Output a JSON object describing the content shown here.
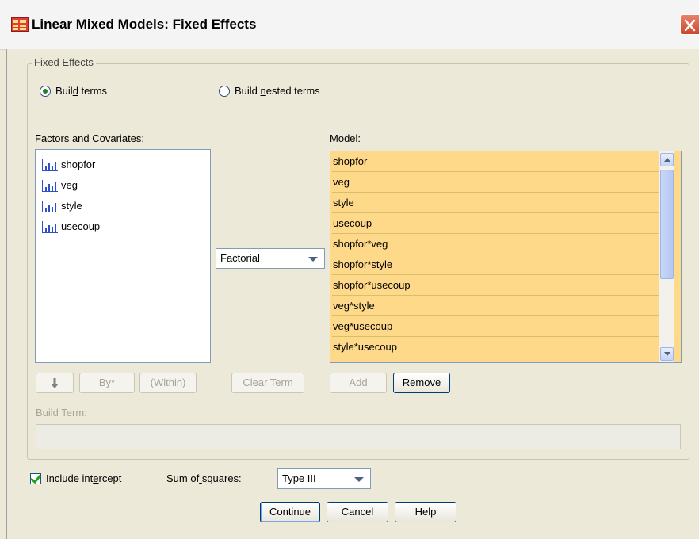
{
  "window": {
    "title": "Linear Mixed Models: Fixed Effects"
  },
  "fixed_effects": {
    "legend": "Fixed Effects",
    "radio_build_terms": {
      "label": "Build terms",
      "selected": true
    },
    "radio_build_nested_terms": {
      "label": "Build nested terms",
      "selected": false
    }
  },
  "factors_covariates": {
    "label": "Factors and Covariates:",
    "items": [
      "shopfor",
      "veg",
      "style",
      "usecoup"
    ]
  },
  "model": {
    "label": "Model:",
    "items": [
      "shopfor",
      "veg",
      "style",
      "usecoup",
      "shopfor*veg",
      "shopfor*style",
      "shopfor*usecoup",
      "veg*style",
      "veg*usecoup",
      "style*usecoup"
    ],
    "highlight_color": "#ffd98a"
  },
  "term_type_dropdown": {
    "value": "Factorial"
  },
  "buttons": {
    "by": "By*",
    "within": "(Within)",
    "clear_term": "Clear Term",
    "add": "Add",
    "remove": "Remove",
    "continue": "Continue",
    "cancel": "Cancel",
    "help": "Help"
  },
  "build_term": {
    "label": "Build Term:",
    "value": ""
  },
  "include_intercept": {
    "label": "Include intercept",
    "checked": true
  },
  "sum_of_squares": {
    "label": "Sum of squares:",
    "value": "Type III"
  },
  "icons": {
    "title": "spreadsheet-table-icon",
    "factor": "ordinal-measure-icon",
    "move": "arrow-down-icon"
  }
}
